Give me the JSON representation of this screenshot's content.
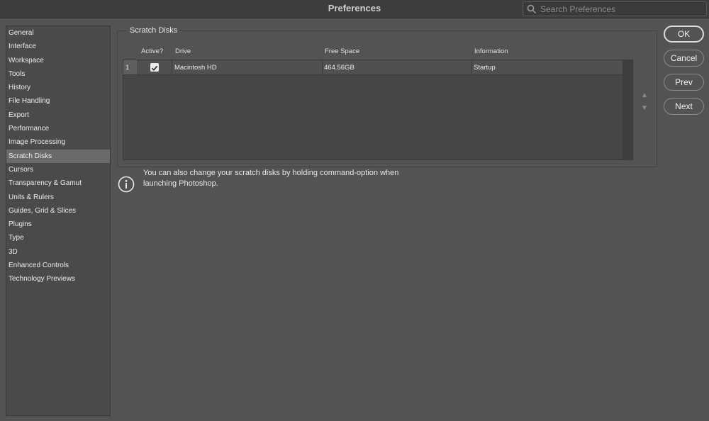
{
  "window": {
    "title": "Preferences",
    "search_placeholder": "Search Preferences"
  },
  "sidebar": {
    "selected": "Scratch Disks",
    "items": [
      {
        "label": "General"
      },
      {
        "label": "Interface"
      },
      {
        "label": "Workspace"
      },
      {
        "label": "Tools"
      },
      {
        "label": "History"
      },
      {
        "label": "File Handling"
      },
      {
        "label": "Export"
      },
      {
        "label": "Performance"
      },
      {
        "label": "Image Processing"
      },
      {
        "label": "Scratch Disks"
      },
      {
        "label": "Cursors"
      },
      {
        "label": "Transparency & Gamut"
      },
      {
        "label": "Units & Rulers"
      },
      {
        "label": "Guides, Grid & Slices"
      },
      {
        "label": "Plugins"
      },
      {
        "label": "Type"
      },
      {
        "label": "3D"
      },
      {
        "label": "Enhanced Controls"
      },
      {
        "label": "Technology Previews"
      }
    ]
  },
  "scratch_disks": {
    "group_title": "Scratch Disks",
    "columns": {
      "active": "Active?",
      "drive": "Drive",
      "free_space": "Free Space",
      "information": "Information"
    },
    "rows": [
      {
        "number": "1",
        "active": true,
        "drive": "Macintosh HD",
        "free_space": "464.56GB",
        "information": "Startup"
      }
    ],
    "move_up_icon": "triangle-up-icon",
    "move_down_icon": "triangle-down-icon"
  },
  "info": {
    "icon": "info-icon",
    "line1": "You can also change your scratch disks by holding command-option when",
    "line2": "launching Photoshop."
  },
  "buttons": {
    "ok": "OK",
    "cancel": "Cancel",
    "prev": "Prev",
    "next": "Next"
  },
  "colors": {
    "background": "#535353",
    "titlebar": "#3d3d3d",
    "sidebar_selected": "#6a6a6a",
    "checkbox": "#e9e9e9"
  }
}
